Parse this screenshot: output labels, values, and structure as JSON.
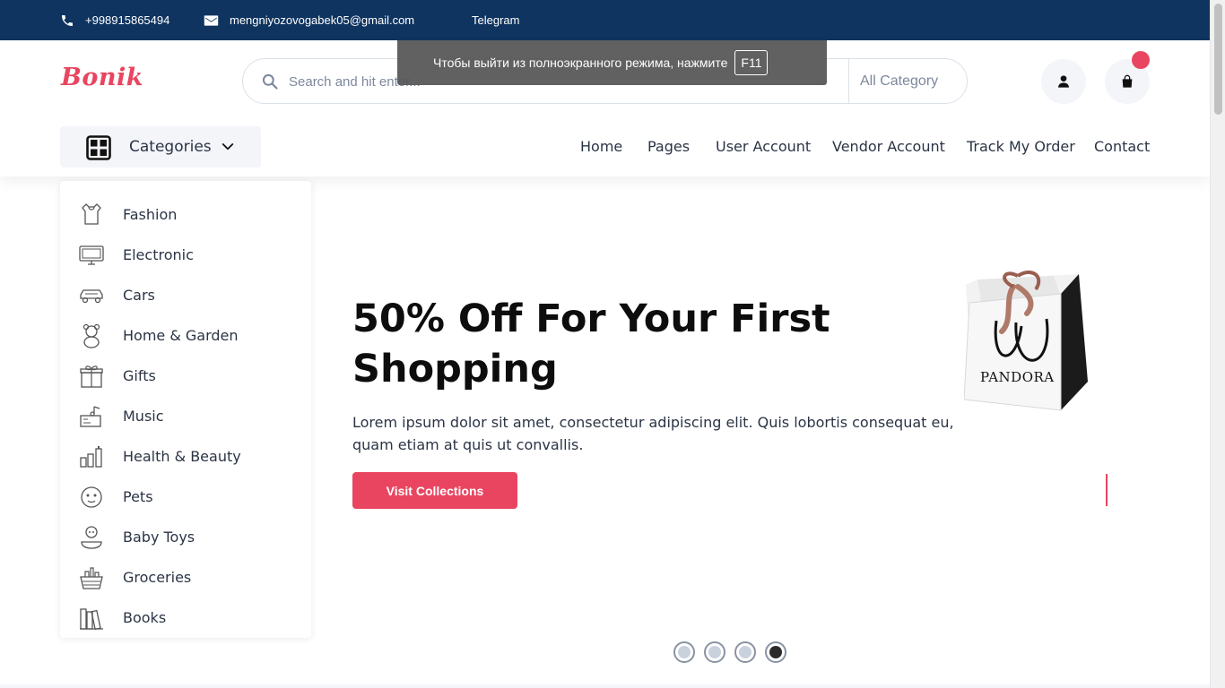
{
  "topbar": {
    "phone": "+998915865494",
    "email": "mengniyozovogabek05@gmail.com",
    "telegram": "Telegram"
  },
  "header": {
    "logo": "Bonik",
    "search_placeholder": "Search and hit enter...",
    "category_select": "All Category",
    "categories_label": "Categories"
  },
  "fullscreen_tip": {
    "text": "Чтобы выйти из полноэкранного режима, нажмите",
    "key": "F11"
  },
  "nav": [
    "Home",
    "Pages",
    "User Account",
    "Vendor Account",
    "Track My Order",
    "Contact"
  ],
  "categories": [
    {
      "label": "Fashion",
      "icon": "dress-icon"
    },
    {
      "label": "Electronic",
      "icon": "monitor-icon"
    },
    {
      "label": "Cars",
      "icon": "car-icon"
    },
    {
      "label": "Home & Garden",
      "icon": "teddy-bear-icon"
    },
    {
      "label": "Gifts",
      "icon": "gift-icon"
    },
    {
      "label": "Music",
      "icon": "music-icon"
    },
    {
      "label": "Health & Beauty",
      "icon": "cosmetics-icon"
    },
    {
      "label": "Pets",
      "icon": "pet-icon"
    },
    {
      "label": "Baby Toys",
      "icon": "baby-icon"
    },
    {
      "label": "Groceries",
      "icon": "basket-icon"
    },
    {
      "label": "Books",
      "icon": "books-icon"
    }
  ],
  "hero": {
    "title": "50% Off For Your First Shopping",
    "text": "Lorem ipsum dolor sit amet, consectetur adipiscing elit. Quis lobortis consequat eu, quam etiam at quis ut convallis.",
    "button": "Visit Collections",
    "bag_brand": "PANDORA"
  },
  "carousel": {
    "count": 4,
    "active": 4
  },
  "colors": {
    "primary": "#e94560",
    "topbar": "#0f3460",
    "text": "#2b3445"
  }
}
